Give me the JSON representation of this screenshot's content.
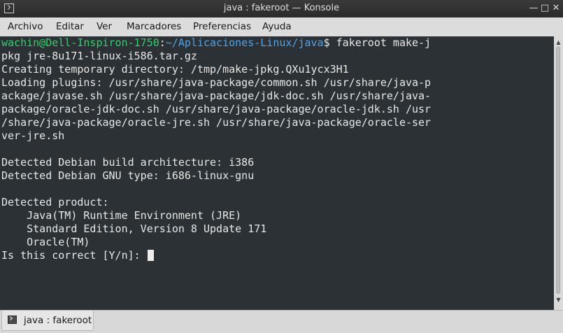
{
  "window": {
    "title": "java : fakeroot — Konsole",
    "minimize_glyph": "—",
    "maximize_glyph": "□",
    "close_glyph": "✕"
  },
  "menubar": {
    "items": [
      "Archivo",
      "Editar",
      "Ver",
      "Marcadores",
      "Preferencias",
      "Ayuda"
    ]
  },
  "terminal": {
    "prompt_user": "wachin@Dell-Inspiron-1750",
    "prompt_colon": ":",
    "prompt_path": "~/Aplicaciones-Linux/java",
    "prompt_dollar": "$ ",
    "command": "fakeroot make-j",
    "lines": [
      "pkg jre-8u171-linux-i586.tar.gz",
      "Creating temporary directory: /tmp/make-jpkg.QXu1ycx3H1",
      "Loading plugins: /usr/share/java-package/common.sh /usr/share/java-p",
      "ackage/javase.sh /usr/share/java-package/jdk-doc.sh /usr/share/java-",
      "package/oracle-jdk-doc.sh /usr/share/java-package/oracle-jdk.sh /usr",
      "/share/java-package/oracle-jre.sh /usr/share/java-package/oracle-ser",
      "ver-jre.sh",
      "",
      "Detected Debian build architecture: i386",
      "Detected Debian GNU type: i686-linux-gnu",
      "",
      "Detected product:",
      "    Java(TM) Runtime Environment (JRE)",
      "    Standard Edition, Version 8 Update 171",
      "    Oracle(TM)"
    ],
    "question": "Is this correct [Y/n]: "
  },
  "scrollbar": {
    "up_glyph": "▲",
    "down_glyph": "▼"
  },
  "tabbar": {
    "tabs": [
      {
        "label": "java : fakeroot"
      }
    ]
  }
}
